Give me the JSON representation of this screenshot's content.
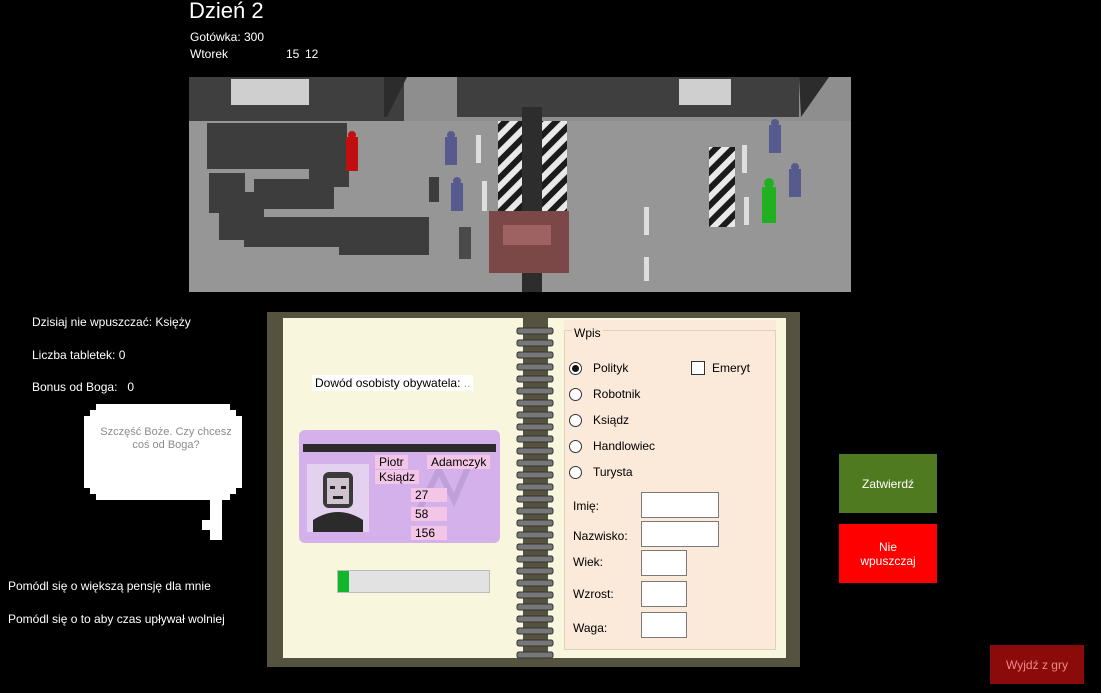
{
  "header": {
    "day_title": "Dzień 2",
    "cash_label": "Gotówka:",
    "cash_value": "300",
    "weekday": "Wtorek",
    "time_hour": "15",
    "time_minute": "12"
  },
  "left_panel": {
    "ban_today": "Dzisiaj nie wpuszczać: Księży",
    "pills": "Liczba tabletek: 0",
    "god_bonus": "Bonus od Boga:   0",
    "bubble_text": "Szczęść Boże. Czy chcesz coś od Boga?",
    "pray_salary": "Pomódl się o większą pensję dla mnie",
    "pray_time": "Pomódl się o to aby czas upływał wolniej"
  },
  "document": {
    "label": "Dowód osobisty obywatela:",
    "ellipsis": "..",
    "first_name": "Piotr",
    "last_name": "Adamczyk",
    "profession": "Ksiądz",
    "age": "27",
    "weight": "58",
    "height": "156"
  },
  "timer": {
    "progress": 0.07
  },
  "form": {
    "title": "Wpis",
    "professions": [
      {
        "label": "Polityk",
        "selected": true
      },
      {
        "label": "Robotnik",
        "selected": false
      },
      {
        "label": "Ksiądz",
        "selected": false
      },
      {
        "label": "Handlowiec",
        "selected": false
      },
      {
        "label": "Turysta",
        "selected": false
      }
    ],
    "retiree_label": "Emeryt",
    "retiree_checked": false,
    "fields": [
      {
        "label": "Imię:",
        "value": ""
      },
      {
        "label": "Nazwisko:",
        "value": ""
      },
      {
        "label": "Wiek:",
        "value": ""
      },
      {
        "label": "Wzrost:",
        "value": ""
      },
      {
        "label": "Waga:",
        "value": ""
      }
    ]
  },
  "buttons": {
    "approve": "Zatwierdź",
    "deny": "Nie wpuszczaj",
    "exit": "Wyjdź z gry"
  },
  "colors": {
    "approve": "#4f7a1f",
    "deny": "#ff0000",
    "exit": "#8b0b0b",
    "card": "#d4b1ea",
    "guard": "#575a8c",
    "selected_person": "#c10f0f",
    "new_arrival": "#21b021",
    "timer_fill": "#12b62a"
  }
}
